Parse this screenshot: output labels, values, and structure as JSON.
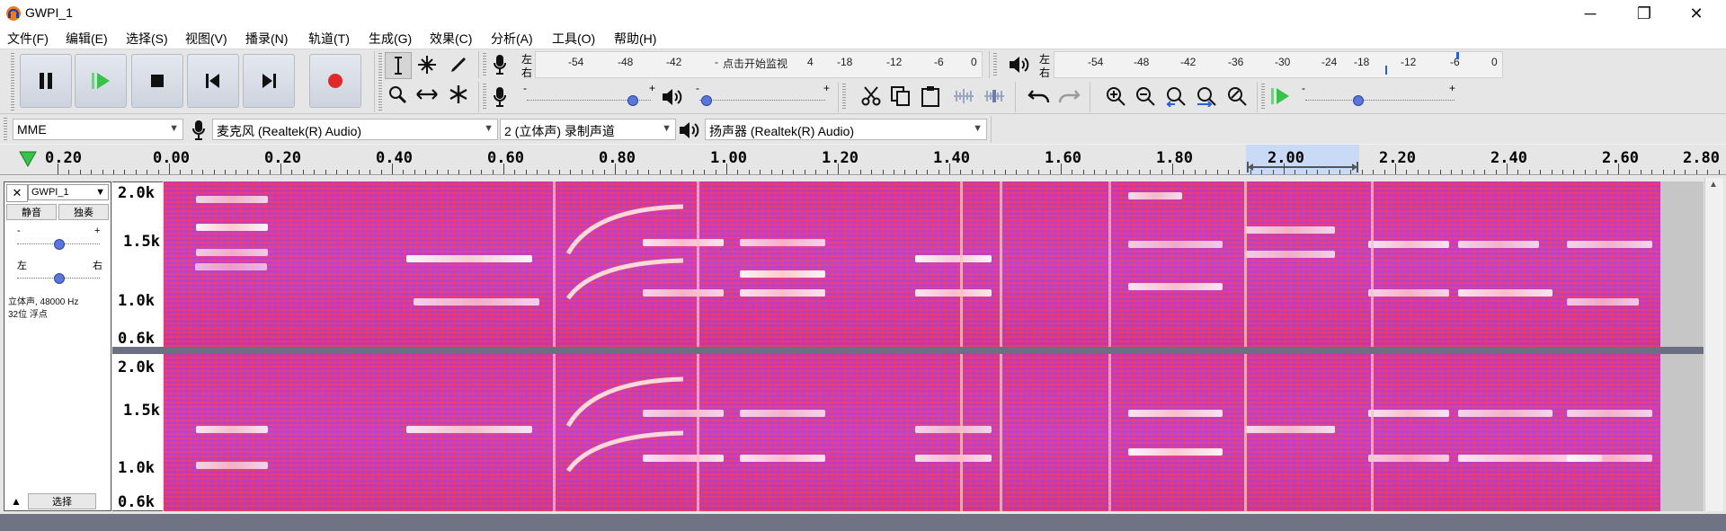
{
  "window": {
    "title": "GWPI_1",
    "minimize_glyph": "─",
    "maximize_glyph": "❐",
    "close_glyph": "✕"
  },
  "menu": [
    "文件(F)",
    "编辑(E)",
    "选择(S)",
    "视图(V)",
    "播录(N)",
    "轨道(T)",
    "生成(G)",
    "效果(C)",
    "分析(A)",
    "工具(O)",
    "帮助(H)"
  ],
  "record_meter": {
    "left_label": "左",
    "right_label": "右",
    "ticks": [
      "-54",
      "-48",
      "-42",
      "-",
      "点击开始监视",
      "4",
      "-18",
      "-12",
      "-6",
      "0"
    ]
  },
  "playback_meter": {
    "left_label": "左",
    "right_label": "右",
    "ticks": [
      "-54",
      "-48",
      "-42",
      "-36",
      "-30",
      "-24",
      "-18",
      "-12",
      "-6",
      "0"
    ]
  },
  "mixer": {
    "record_volume": 0.85,
    "playback_volume": 0.05,
    "play_at_speed": 0.35,
    "minus": "-",
    "plus": "+"
  },
  "device_bar": {
    "host": "MME",
    "recording_device": "麦克风 (Realtek(R) Audio)",
    "channels": "2 (立体声) 录制声道",
    "playback_device": "扬声器 (Realtek(R) Audio)"
  },
  "ruler": {
    "labels": [
      "0.20",
      "0.00",
      "0.20",
      "0.40",
      "0.60",
      "0.80",
      "1.00",
      "1.20",
      "1.40",
      "1.60",
      "1.80",
      "2.00",
      "2.20",
      "2.40",
      "2.60",
      "2.80"
    ]
  },
  "track": {
    "name": "GWPI_1",
    "mute": "静音",
    "solo": "独奏",
    "gain_minus": "-",
    "gain_plus": "+",
    "pan_left": "左",
    "pan_right": "右",
    "gain": 0.5,
    "pan": 0.5,
    "info_line1": "立体声, 48000 Hz",
    "info_line2": "32位 浮点",
    "select": "选择",
    "freq_labels": [
      "2.0k",
      "1.5k",
      "1.0k",
      "0.6k"
    ]
  },
  "colors": {
    "spectrogram_hot": "#e8306e",
    "spectrogram_cool": "#9b4cf0",
    "band": "#ffffff",
    "record": "#e02a2a",
    "play_green": "#37c24a",
    "selection": "#c8daf5"
  }
}
